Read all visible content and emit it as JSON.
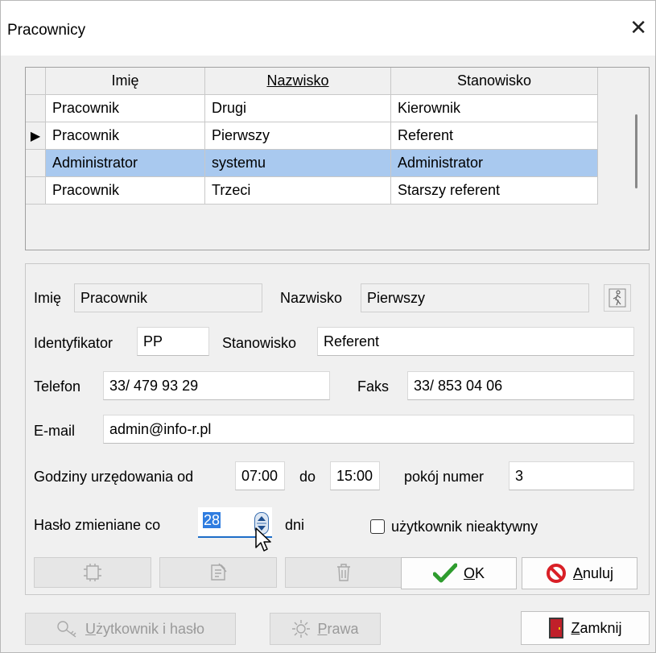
{
  "window": {
    "title": "Pracownicy",
    "close_glyph": "✕"
  },
  "grid": {
    "columns": [
      "Imię",
      "Nazwisko",
      "Stanowisko"
    ],
    "rows": [
      {
        "imie": "Pracownik",
        "nazwisko": "Drugi",
        "stanowisko": "Kierownik"
      },
      {
        "imie": "Pracownik",
        "nazwisko": "Pierwszy",
        "stanowisko": "Referent"
      },
      {
        "imie": "Administrator",
        "nazwisko": "systemu",
        "stanowisko": "Administrator"
      },
      {
        "imie": "Pracownik",
        "nazwisko": "Trzeci",
        "stanowisko": "Starszy referent"
      }
    ],
    "current_row_marker": "▶"
  },
  "form": {
    "imie_label": "Imię",
    "imie_value": "Pracownik",
    "nazwisko_label": "Nazwisko",
    "nazwisko_value": "Pierwszy",
    "identyfikator_label": "Identyfikator",
    "identyfikator_value": "PP",
    "stanowisko_label": "Stanowisko",
    "stanowisko_value": "Referent",
    "telefon_label": "Telefon",
    "telefon_value": "33/ 479 93 29",
    "faks_label": "Faks",
    "faks_value": "33/ 853 04 06",
    "email_label": "E-mail",
    "email_value": "admin@info-r.pl",
    "godziny_label": "Godziny urzędowania od",
    "godziny_od": "07:00",
    "do_label": "do",
    "godziny_do": "15:00",
    "pokoj_label": "pokój numer",
    "pokoj_value": "3",
    "haslo_label": "Hasło zmieniane co",
    "haslo_value": "28",
    "dni_label": "dni",
    "nieaktywny_label": "użytkownik nieaktywny"
  },
  "buttons": {
    "ok_label": "OK",
    "ok_key": "O",
    "ok_rest": "K",
    "anuluj_key": "A",
    "anuluj_rest": "nuluj",
    "uzytkownik_key": "U",
    "uzytkownik_rest": "żytkownik i hasło",
    "prawa_key": "P",
    "prawa_rest": "rawa",
    "zamknij_key": "Z",
    "zamknij_rest": "amknij"
  },
  "icons": [
    "walking-person-icon",
    "new-record-icon",
    "edit-record-icon",
    "delete-trash-icon",
    "checkmark-icon",
    "cancel-circle-icon",
    "key-icon",
    "gear-icon",
    "door-icon",
    "mouse-cursor-icon"
  ],
  "colors": {
    "selection": "#a9c9ef",
    "check_green": "#2e9c2e",
    "cancel_red": "#d91f26",
    "door_red": "#c0202a"
  }
}
